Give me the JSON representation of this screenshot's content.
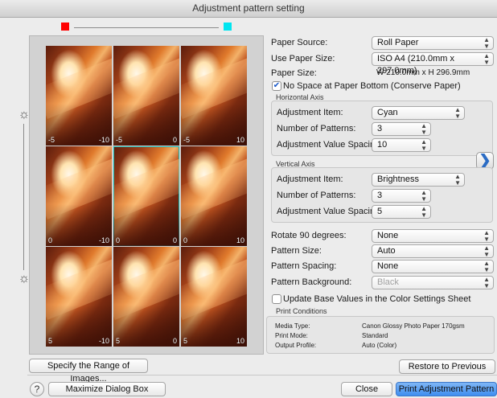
{
  "window": {
    "title": "Adjustment pattern setting"
  },
  "colors": {
    "left_swatch": "#ff0000",
    "right_swatch": "#00e5f0",
    "accent": "#3f8ef0",
    "center_outline": "#18b8b0"
  },
  "icons": {
    "brightness_top": "sun-icon",
    "brightness_bottom": "sun-icon"
  },
  "preview": {
    "cells": [
      {
        "left": "-5",
        "right": "-10"
      },
      {
        "left": "-5",
        "right": "0"
      },
      {
        "left": "-5",
        "right": "10"
      },
      {
        "left": "0",
        "right": "-10"
      },
      {
        "left": "0",
        "right": "0"
      },
      {
        "left": "0",
        "right": "10"
      },
      {
        "left": "5",
        "right": "-10"
      },
      {
        "left": "5",
        "right": "0"
      },
      {
        "left": "5",
        "right": "10"
      }
    ]
  },
  "settings": {
    "paper_source": {
      "label": "Paper Source:",
      "value": "Roll Paper"
    },
    "use_paper_size": {
      "label": "Use Paper Size:",
      "value": "ISO A4 (210.0mm x 297.0mm)"
    },
    "paper_size": {
      "label": "Paper Size:",
      "value": "W 210.0mm x H 296.9mm"
    },
    "no_space": {
      "label": "No Space at Paper Bottom (Conserve Paper)",
      "checked": true
    },
    "horizontal_axis": {
      "title": "Horizontal Axis",
      "item": {
        "label": "Adjustment Item:",
        "value": "Cyan"
      },
      "patterns": {
        "label": "Number of Patterns:",
        "value": "3"
      },
      "spacing": {
        "label": "Adjustment Value Spacing:",
        "value": "10"
      }
    },
    "vertical_axis": {
      "title": "Vertical Axis",
      "item": {
        "label": "Adjustment Item:",
        "value": "Brightness"
      },
      "patterns": {
        "label": "Number of Patterns:",
        "value": "3"
      },
      "spacing": {
        "label": "Adjustment Value Spacing:",
        "value": "5"
      }
    },
    "rotate": {
      "label": "Rotate 90 degrees:",
      "value": "None"
    },
    "pattern_size": {
      "label": "Pattern Size:",
      "value": "Auto"
    },
    "pattern_spacing": {
      "label": "Pattern Spacing:",
      "value": "None"
    },
    "pattern_background": {
      "label": "Pattern Background:",
      "value": "Black"
    },
    "update_base": {
      "label": "Update Base Values in the Color Settings Sheet",
      "checked": false
    },
    "print_conditions": {
      "title": "Print Conditions",
      "media_type": {
        "label": "Media Type:",
        "value": "Canon Glossy Photo Paper 170gsm"
      },
      "print_mode": {
        "label": "Print Mode:",
        "value": "Standard"
      },
      "output_profile": {
        "label": "Output Profile:",
        "value": "Auto (Color)"
      }
    }
  },
  "buttons": {
    "specify_range": "Specify the Range of Images...",
    "restore": "Restore to Previous",
    "help": "?",
    "maximize": "Maximize Dialog Box",
    "close": "Close",
    "print": "Print Adjustment Pattern",
    "next": "❯"
  }
}
